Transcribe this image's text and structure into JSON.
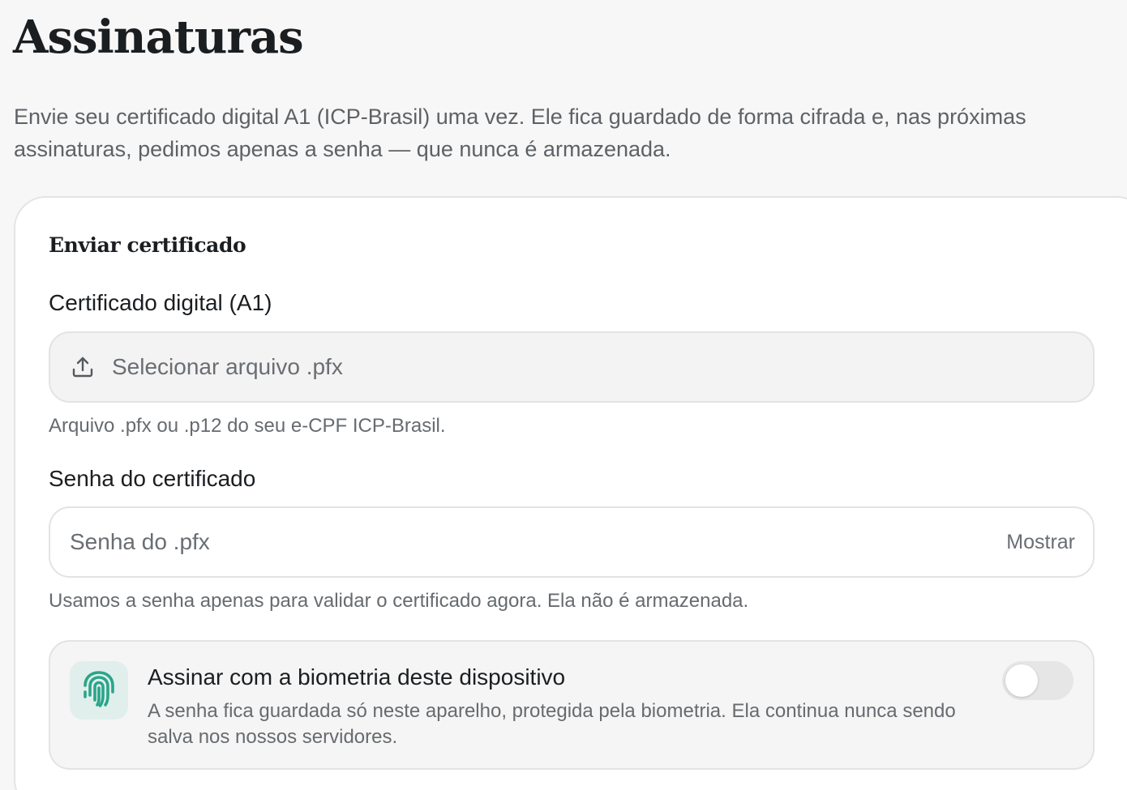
{
  "page": {
    "title": "Assinaturas",
    "description": "Envie seu certificado digital A1 (ICP-Brasil) uma vez. Ele fica guardado de forma cifrada e, nas próximas assinaturas, pedimos apenas a senha — que nunca é armazenada."
  },
  "card": {
    "title": "Enviar certificado",
    "certificate": {
      "label": "Certificado digital (A1)",
      "picker_text": "Selecionar arquivo .pfx",
      "icon": "upload-icon",
      "hint": "Arquivo .pfx ou .p12 do seu e-CPF ICP-Brasil."
    },
    "password": {
      "label": "Senha do certificado",
      "placeholder": "Senha do .pfx",
      "value": "",
      "show_label": "Mostrar",
      "hint": "Usamos a senha apenas para validar o certificado agora. Ela não é armazenada."
    },
    "biometric": {
      "title": "Assinar com a biometria deste dispositivo",
      "description": "A senha fica guardada só neste aparelho, protegida pela biometria. Ela continua nunca sendo salva nos nossos servidores.",
      "icon": "fingerprint-icon",
      "enabled": false
    }
  },
  "colors": {
    "accent": "#2aa58a",
    "accent_bg": "#e0efeb",
    "page_bg": "#f7f7f7"
  }
}
